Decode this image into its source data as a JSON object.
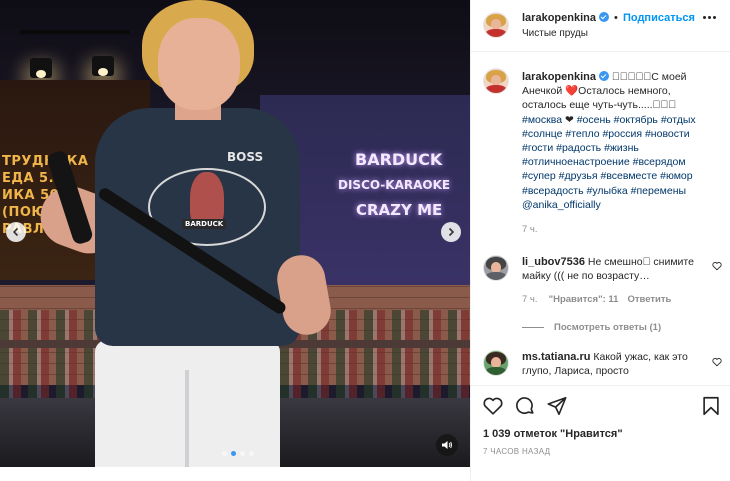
{
  "post": {
    "author": "larakopenkina",
    "follow_label": "Подписаться",
    "location": "Чистые пруды",
    "caption": {
      "username": "larakopenkina",
      "text": "􀀀􀀀􀀀􀀀􀀀С моей Анечкой ❤️Осталось немного, осталось еще чуть-чуть.....􀀀􀀀􀀀",
      "hashtags": [
        "#москва",
        "❤",
        "#осень",
        "#октябрь",
        "#отдых",
        "#солнце",
        "#тепло",
        "#россия",
        "#новости",
        "#гости",
        "#радость",
        "#жизнь",
        "#отличноенастроение",
        "#всерядом",
        "#супер",
        "#друзья",
        "#всевместе",
        "#юмор",
        "#всерадость",
        "#улыбка",
        "#перемены"
      ],
      "mention": "@anika_officially",
      "time": "7 ч."
    },
    "comments": [
      {
        "username": "li_ubov7536",
        "text": "Не смешно􀀀 снимите майку ((( не по возрасту…",
        "time": "7 ч.",
        "likes": "\"Нравится\": 11",
        "reply_label": "Ответить",
        "view_replies": "Посмотреть ответы (1)"
      },
      {
        "username": "ms.tatiana.ru",
        "text": "Какой ужас, как это глупо, Лариса, просто"
      }
    ],
    "likes_text": "1 039 отметок \"Нравится\"",
    "timestamp": "7 ЧАСОВ НАЗАД"
  },
  "media": {
    "board_lines": [
      "ТРУДНИКА",
      "ЕДА 5.0",
      "ИКА 50.00",
      "(ПОЮ О",
      "РАВЛЯЮ) ("
    ],
    "neon_lines": [
      "BARDUCK",
      "DISCO-KARAOKE",
      "CRAZY ME"
    ],
    "shirt_text": "BOSS",
    "shirt_badge": "BARDUCK",
    "slide_count": 4,
    "active_slide": 2
  },
  "icons": {
    "prev": "chevron-left-icon",
    "next": "chevron-right-icon",
    "sound": "speaker-icon",
    "like": "heart-icon",
    "comment": "comment-icon",
    "share": "send-icon",
    "save": "bookmark-icon",
    "more": "more-horizontal-icon",
    "verified": "verified-badge-icon"
  },
  "colors": {
    "link": "#0095f6",
    "hashtag": "#00376b",
    "muted": "#8e8e8e",
    "verified": "#3897f0"
  }
}
